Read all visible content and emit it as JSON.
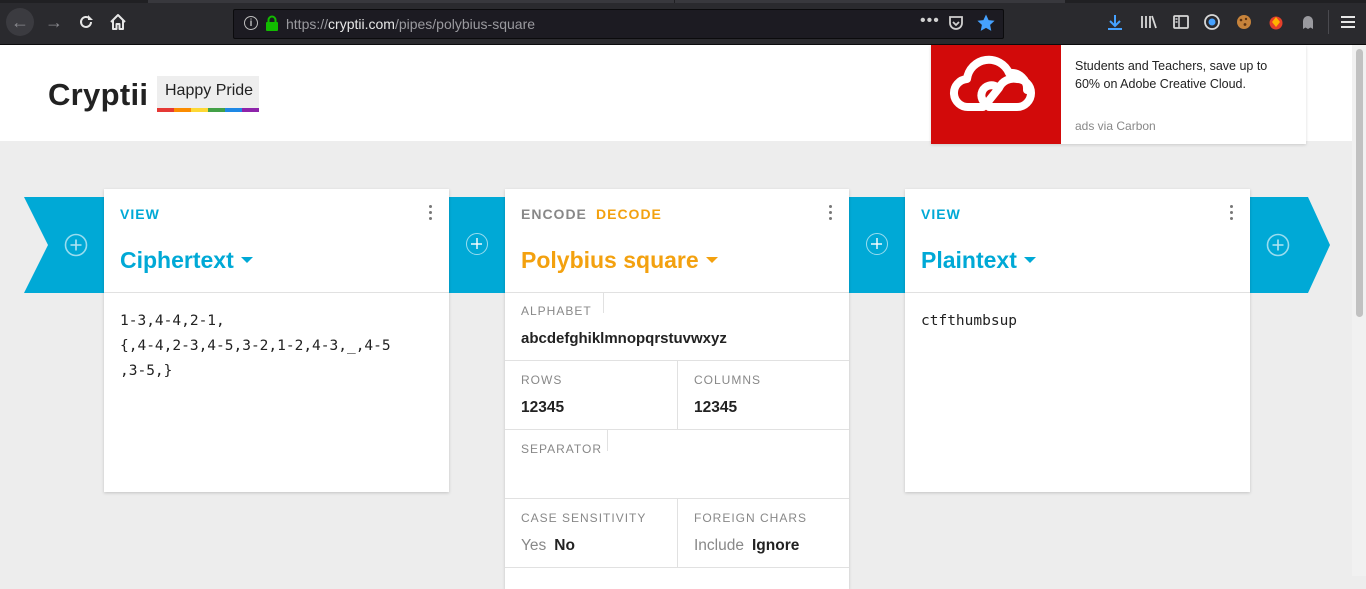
{
  "browser": {
    "url_scheme": "https://",
    "url_host": "cryptii.com",
    "url_path": "/pipes/polybius-square",
    "more_glyph": "•••"
  },
  "header": {
    "logo": "Cryptii",
    "pride_label": "Happy Pride",
    "pride_colors": [
      "#e53935",
      "#fb8c00",
      "#fdd835",
      "#43a047",
      "#1e88e5",
      "#8e24aa"
    ]
  },
  "ad": {
    "text": "Students and Teachers, save up to 60% on Adobe Creative Cloud.",
    "via": "ads via Carbon"
  },
  "colors": {
    "view": "#00a9d6",
    "encoder": "#f3a10f"
  },
  "bricks": {
    "left": {
      "mode": "VIEW",
      "title": "Ciphertext",
      "content": "1-3,4-4,2-1,\n{,4-4,2-3,4-5,3-2,1-2,4-3,_,4-5\n,3-5,}"
    },
    "middle": {
      "mode_encode": "ENCODE",
      "mode_decode": "DECODE",
      "title": "Polybius square",
      "alphabet_label": "ALPHABET",
      "alphabet_value": "abcdefghiklmnopqrstuvwxyz",
      "rows_label": "ROWS",
      "rows_value": "12345",
      "columns_label": "COLUMNS",
      "columns_value": "12345",
      "separator_label": "SEPARATOR",
      "separator_value": "",
      "case_label": "CASE SENSITIVITY",
      "case_yes": "Yes",
      "case_no": "No",
      "foreign_label": "FOREIGN CHARS",
      "foreign_include": "Include",
      "foreign_ignore": "Ignore"
    },
    "right": {
      "mode": "VIEW",
      "title": "Plaintext",
      "content": "ctfthumbsup"
    }
  }
}
